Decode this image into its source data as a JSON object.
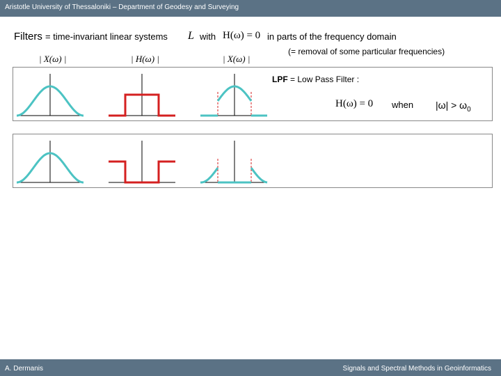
{
  "header": {
    "title": "Aristotle University of Thessaloniki – Department of Geodesy and Surveying"
  },
  "footer": {
    "author": "A. Dermanis",
    "course": "Signals and Spectral Methods in Geoinformatics"
  },
  "slide": {
    "filters_word": "Filters",
    "intro": "= time-invariant linear systems",
    "L": "L",
    "with": "with",
    "condition": "H(ω) = 0",
    "in_parts": "in parts of the frequency domain",
    "removal": "(= removal of some particular frequencies)",
    "col_labels": [
      "| X(ω) |",
      "| H(ω) |",
      "| X(ω) |"
    ],
    "lpf_abbr": "LPF",
    "lpf_rest": "= Low Pass Filter :",
    "lpf_eq": "H(ω) = 0",
    "lpf_when": "when",
    "lpf_cond": "|ω| > ω",
    "lpf_sub": "0"
  },
  "colors": {
    "signal": "#4cc3c3",
    "filter": "#d42020",
    "header": "#5b7285"
  }
}
